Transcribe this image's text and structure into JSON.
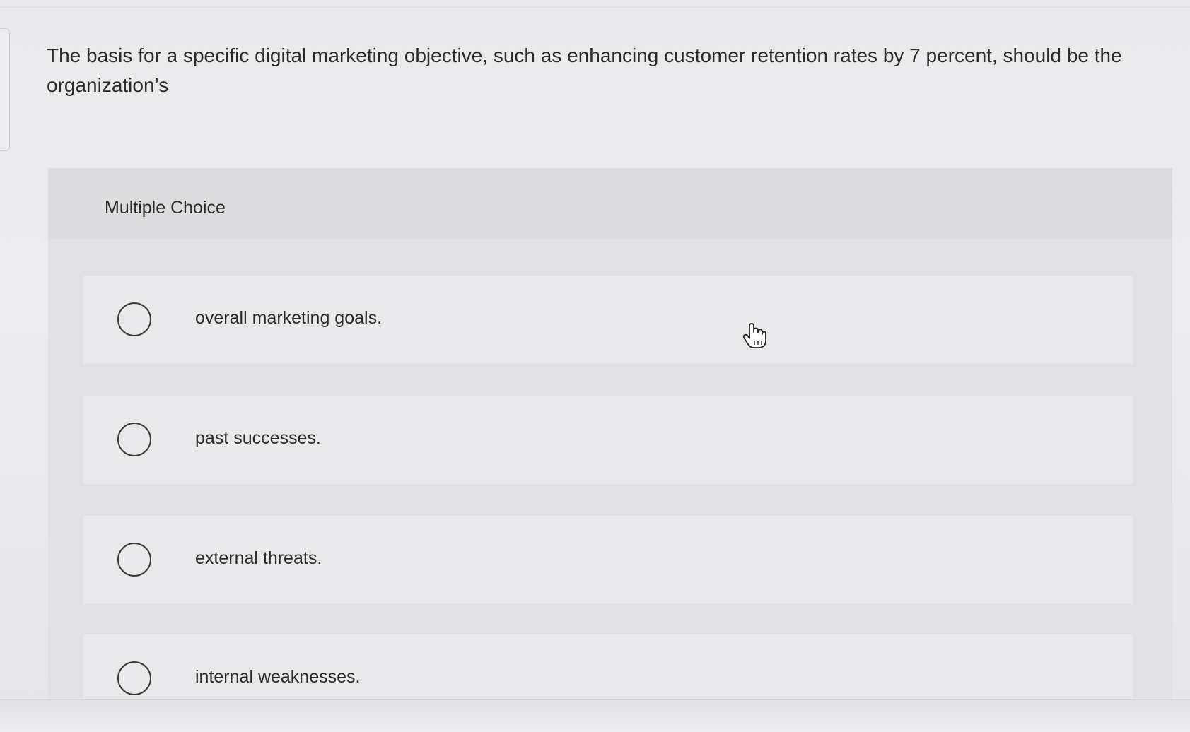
{
  "question": {
    "text": "The basis for a specific digital marketing objective, such as enhancing customer retention rates by 7 percent, should be the organization’s"
  },
  "panel": {
    "header": "Multiple Choice"
  },
  "options": [
    {
      "label": "overall marketing goals."
    },
    {
      "label": "past successes."
    },
    {
      "label": "external threats."
    },
    {
      "label": "internal weaknesses."
    }
  ],
  "icons": {
    "cursor": "hand-pointer-icon",
    "radio": "radio-circle-icon"
  }
}
